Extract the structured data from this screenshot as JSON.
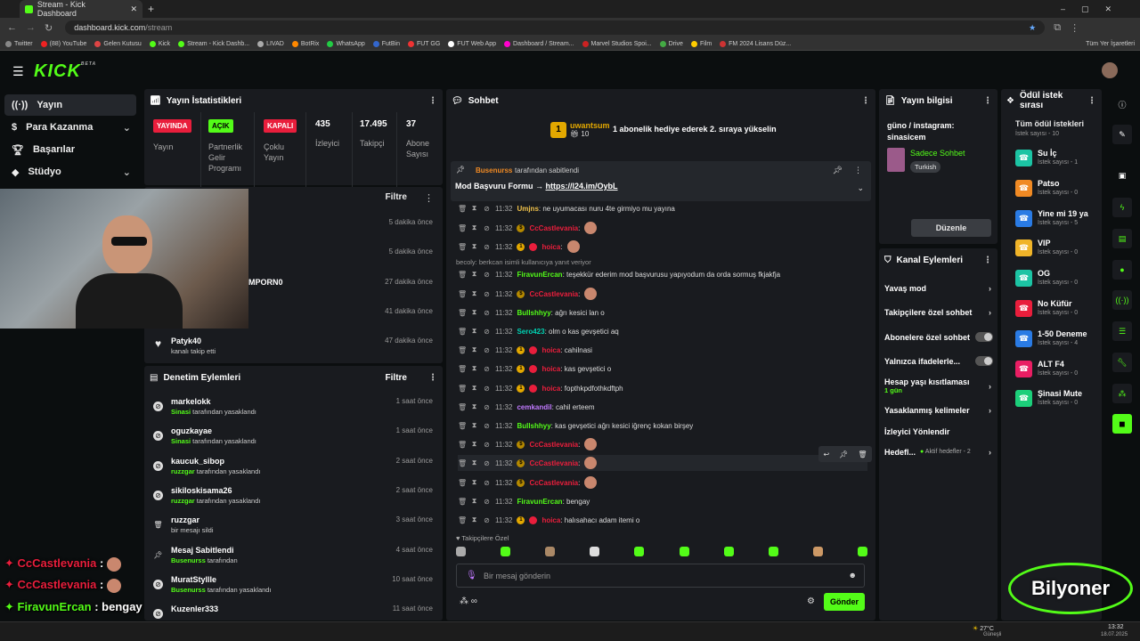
{
  "browser": {
    "tab_title": "Stream - Kick Dashboard",
    "url_host": "dashboard.kick.com",
    "url_path": "/stream",
    "bookmarks": [
      "Twitter",
      "(88) YouTube",
      "Gelen Kutusu",
      "Kick",
      "Stream - Kick Dashb...",
      "LIVAD",
      "BotRix",
      "WhatsApp",
      "FutBin",
      "FUT GG",
      "FUT Web App",
      "Dashboard / Stream...",
      "Marvel Studios Spoi...",
      "Drive",
      "Film",
      "FM 2024 Lisans Düz..."
    ],
    "bookmarks_right": "Tüm Yer İşaretleri"
  },
  "logo": {
    "text": "KICK",
    "beta": "BETA"
  },
  "nav": {
    "items": [
      {
        "label": "Yayın"
      },
      {
        "label": "Para Kazanma"
      },
      {
        "label": "Başarılar"
      },
      {
        "label": "Stüdyo"
      }
    ]
  },
  "stats": {
    "title": "Yayın İstatistikleri",
    "items": [
      {
        "badge": "YAYINDA",
        "label": "Yayın",
        "color": "#e91e3c"
      },
      {
        "badge": "AÇIK",
        "label": "Partnerlik Gelir Programı",
        "color": "#53fc18"
      },
      {
        "badge": "KAPALI",
        "label": "Çoklu Yayın",
        "color": "#e91e3c"
      },
      {
        "num": "435",
        "label": "İzleyici"
      },
      {
        "num": "17.495",
        "label": "Takipçi"
      },
      {
        "num": "37",
        "label": "Abone Sayısı"
      }
    ]
  },
  "activity": {
    "filter": "Filtre",
    "rows": [
      {
        "name": "",
        "time": "5 dakika önce"
      },
      {
        "name": "",
        "time": "5 dakika önce"
      },
      {
        "name": "MPORN0",
        "time": "27 dakika önce"
      },
      {
        "name": "",
        "time": "41 dakika önce"
      },
      {
        "name": "Patyk40",
        "sub": "kanalı takip etti",
        "time": "47 dakika önce"
      }
    ]
  },
  "moderation": {
    "title": "Denetim Eylemleri",
    "filter": "Filtre",
    "rows": [
      {
        "name": "markelokk",
        "by": "Sinasi",
        "action": " tarafından yasaklandı",
        "time": "1 saat önce"
      },
      {
        "name": "oguzkayae",
        "by": "Sinasi",
        "action": " tarafından yasaklandı",
        "time": "1 saat önce"
      },
      {
        "name": "kaucuk_sibop",
        "by": "ruzzgar",
        "action": " tarafından yasaklandı",
        "time": "2 saat önce"
      },
      {
        "name": "sikiloskisama26",
        "by": "ruzzgar",
        "action": " tarafından yasaklandı",
        "time": "2 saat önce"
      },
      {
        "name": "ruzzgar",
        "by": "",
        "action": "bir mesajı sildi",
        "time": "3 saat önce"
      },
      {
        "name": "Mesaj Sabitlendi",
        "by": "Busenurss",
        "action": " tarafından",
        "time": "4 saat önce"
      },
      {
        "name": "MuratStyllle",
        "by": "Busenurss",
        "action": " tarafından yasaklandı",
        "time": "10 saat önce"
      },
      {
        "name": "Kuzenler333",
        "by": "",
        "action": "",
        "time": "11 saat önce"
      }
    ]
  },
  "chat": {
    "title": "Sohbet",
    "gift_user": "uwantsum",
    "gift_count": "10",
    "gift_text": "1 abonelik hediye ederek 2. sıraya yükselin",
    "pinned_by": "Busenurss",
    "pinned_by_suffix": " tarafından sabitlendi",
    "pinned_text": "Mod Başvuru Formu → ",
    "pinned_link": "https://l24.im/OybL",
    "reply_note": "becoly: berkcan isimli kullanıcıya yanıt veriyor",
    "messages": [
      {
        "time": "11:32",
        "user": "Umjns",
        "color": "#f0c24b",
        "text": ": ne uyumacası nuru 4te girmiyo mu yayına",
        "badge": ""
      },
      {
        "time": "11:32",
        "user": "CcCastlevania",
        "color": "#e91e3c",
        "text": ":",
        "badge": "s",
        "emote": true
      },
      {
        "time": "11:32",
        "user": "hoica",
        "color": "#e91e3c",
        "text": ":",
        "badge": "c",
        "emote": true
      },
      {
        "time": "11:32",
        "user": "FiravunErcan",
        "color": "#53fc18",
        "text": ": teşekkür ederim mod başvurusu yapıyodum da orda sormuş fkjakfja",
        "badge": ""
      },
      {
        "time": "11:32",
        "user": "CcCastlevania",
        "color": "#e91e3c",
        "text": ":",
        "badge": "s",
        "emote": true
      },
      {
        "time": "11:32",
        "user": "Bullshhyy",
        "color": "#53fc18",
        "text": ": ağrı kesici lan o",
        "badge": ""
      },
      {
        "time": "11:32",
        "user": "Sero423",
        "color": "#00d1b2",
        "text": ": olm o kas gevşetici aq",
        "badge": ""
      },
      {
        "time": "11:32",
        "user": "hoica",
        "color": "#e91e3c",
        "text": ": cahilnasi",
        "badge": "c"
      },
      {
        "time": "11:32",
        "user": "hoica",
        "color": "#e91e3c",
        "text": ": kas gevşetici o",
        "badge": "c"
      },
      {
        "time": "11:32",
        "user": "hoica",
        "color": "#e91e3c",
        "text": ": fopthkpdfothkdftph",
        "badge": "c"
      },
      {
        "time": "11:32",
        "user": "cemkandil",
        "color": "#c17aff",
        "text": ": cahil erteem",
        "badge": ""
      },
      {
        "time": "11:32",
        "user": "Bullshhyy",
        "color": "#53fc18",
        "text": ": kas gevşetici ağrı kesici iğrenç kokan birşey",
        "badge": ""
      },
      {
        "time": "11:32",
        "user": "CcCastlevania",
        "color": "#e91e3c",
        "text": ":",
        "badge": "s",
        "emote": true
      },
      {
        "time": "11:32",
        "user": "CcCastlevania",
        "color": "#e91e3c",
        "text": ":",
        "badge": "s",
        "emote": true
      },
      {
        "time": "11:32",
        "user": "CcCastlevania",
        "color": "#e91e3c",
        "text": ":",
        "badge": "s",
        "emote": true
      },
      {
        "time": "11:32",
        "user": "FiravunErcan",
        "color": "#53fc18",
        "text": ": bengay",
        "badge": ""
      },
      {
        "time": "11:32",
        "user": "hoica",
        "color": "#e91e3c",
        "text": ": halısahacı adam itemi o",
        "badge": "c"
      }
    ],
    "followers_only": "Takipçilere Özel",
    "input_placeholder": "Bir mesaj gönderin",
    "send": "Gönder"
  },
  "stream_info": {
    "title": "Yayın bilgisi",
    "stream_title": "güno / instagram: sinasicem",
    "category": "Sadece Sohbet",
    "tag": "Turkish",
    "edit": "Düzenle"
  },
  "channel_actions": {
    "title": "Kanal Eylemleri",
    "items": [
      {
        "label": "Yavaş mod",
        "type": "chev"
      },
      {
        "label": "Takipçilere özel sohbet",
        "type": "chev"
      },
      {
        "label": "Abonelere özel sohbet",
        "type": "toggle"
      },
      {
        "label": "Yalnızca ifadelerle...",
        "type": "toggle"
      },
      {
        "label": "Hesap yaşı kısıtlaması",
        "sub": "1 gün",
        "type": "chev"
      },
      {
        "label": "Yasaklanmış kelimeler",
        "type": "chev"
      },
      {
        "label": "İzleyici Yönlendir",
        "type": "none"
      },
      {
        "label": "Hedefl...",
        "sub2": "Aktif hedefler - 2",
        "type": "chev"
      }
    ]
  },
  "rewards": {
    "title": "Ödül istek sırası",
    "all": "Tüm ödül istekleri",
    "all_count": "İstek sayısı - 10",
    "items": [
      {
        "name": "Su İç",
        "count": "İstek sayısı - 1",
        "color": "#1cc4a4"
      },
      {
        "name": "Patso",
        "count": "İstek sayısı - 0",
        "color": "#f08a24"
      },
      {
        "name": "Yine mi 19 ya",
        "count": "İstek sayısı - 5",
        "color": "#2a7be4"
      },
      {
        "name": "VIP",
        "count": "İstek sayısı - 0",
        "color": "#f0b429"
      },
      {
        "name": "OG",
        "count": "İstek sayısı - 0",
        "color": "#1cc4a4"
      },
      {
        "name": "No Küfür",
        "count": "İstek sayısı - 0",
        "color": "#e91e3c"
      },
      {
        "name": "1-50 Deneme",
        "count": "İstek sayısı - 4",
        "color": "#2a7be4"
      },
      {
        "name": "ALT F4",
        "count": "İstek sayısı - 0",
        "color": "#e91e63"
      },
      {
        "name": "Şinasi Mute",
        "count": "İstek sayısı - 0",
        "color": "#1ccf7a"
      }
    ]
  },
  "overlay": {
    "lines": [
      {
        "user": "CcCastlevania",
        "text": " : ",
        "color": "#e91e3c"
      },
      {
        "user": "CcCastlevania",
        "text": " : ",
        "color": "#e91e3c"
      },
      {
        "user": "FiravunErcan",
        "text": " : bengay",
        "color": "#53fc18"
      },
      {
        "user": "hoica",
        "text": " : halısahacı adam itemi o",
        "color": "#e91e3c"
      }
    ],
    "watermark": "Bilyoner"
  },
  "taskbar": {
    "temp": "27°C",
    "weather": "Güneşli",
    "time": "13:32",
    "date": "18.07.2025"
  }
}
